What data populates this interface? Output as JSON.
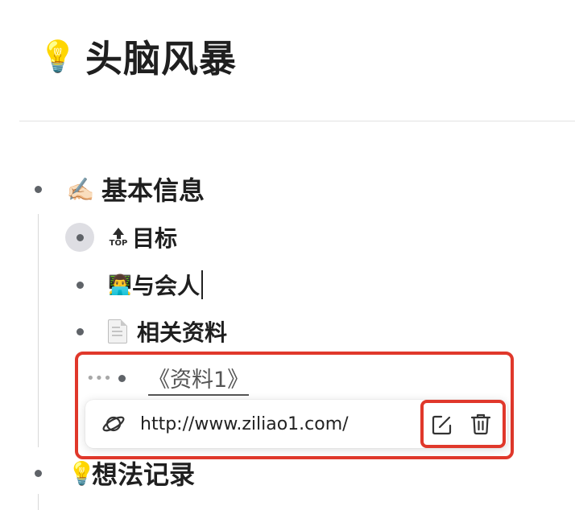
{
  "page": {
    "emoji": "💡",
    "title": "头脑风暴"
  },
  "outline": {
    "basic_info": {
      "emoji": "✍🏻",
      "label": "基本信息"
    },
    "goal": {
      "icon": "top-icon",
      "icon_text": "TOP",
      "label": "目标"
    },
    "attendees": {
      "emoji": "👨‍💻",
      "label": "与会人"
    },
    "materials": {
      "icon": "document-icon",
      "label": "相关资料"
    },
    "material_link": {
      "label": "《资料1》"
    },
    "ideas": {
      "emoji": "💡",
      "label": "想法记录"
    }
  },
  "link_popup": {
    "icon": "planet-icon",
    "url": "http://www.ziliao1.com/",
    "actions": [
      {
        "icon": "edit-icon"
      },
      {
        "icon": "trash-icon"
      }
    ]
  },
  "colors": {
    "highlight": "#e0382b",
    "bullet": "#5f6368",
    "bullet_ring": "#dedee3",
    "link_text": "#555555"
  }
}
